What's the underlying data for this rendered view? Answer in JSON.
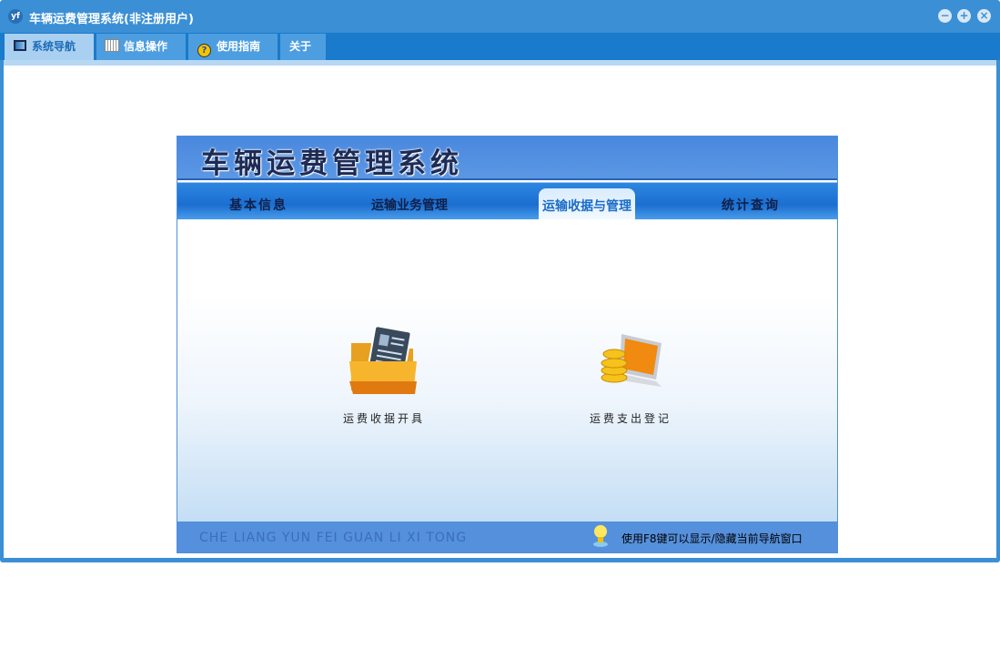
{
  "window": {
    "title": "车辆运费管理系统(非注册用户)",
    "logo": "yf",
    "controls": [
      "minimize",
      "restore",
      "close"
    ]
  },
  "menu": [
    {
      "label": "系统导航",
      "icon": "monitor-icon",
      "active": true
    },
    {
      "label": "信息操作",
      "icon": "grid-icon"
    },
    {
      "label": "使用指南",
      "icon": "help-icon"
    },
    {
      "label": "关于"
    }
  ],
  "panel": {
    "title": "车辆运费管理系统",
    "tabs": [
      {
        "label": "基本信息"
      },
      {
        "label": "运输业务管理"
      },
      {
        "label": "运输收据与管理",
        "active": true
      },
      {
        "label": "统计查询"
      }
    ],
    "items": [
      {
        "label": "运费收据开具",
        "icon": "folder-document-icon"
      },
      {
        "label": "运费支出登记",
        "icon": "laptop-coins-icon"
      }
    ],
    "footer_pinyin": "CHE LIANG YUN FEI GUAN LI XI TONG",
    "footer_hint": "使用F8键可以显示/隐藏当前导航窗口"
  }
}
